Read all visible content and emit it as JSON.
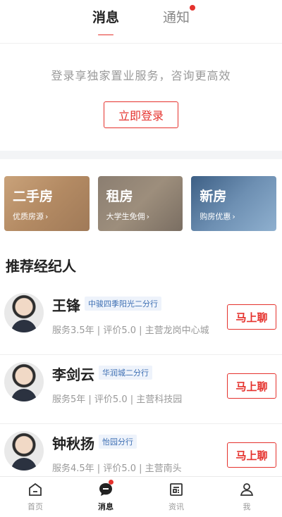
{
  "tabs": [
    {
      "label": "消息",
      "active": true
    },
    {
      "label": "通知",
      "active": false,
      "has_dot": true
    }
  ],
  "login": {
    "tip": "登录享独家置业服务，咨询更高效",
    "button": "立即登录"
  },
  "cards": [
    {
      "title": "二手房",
      "subtitle": "优质房源",
      "theme": "#c9a27a"
    },
    {
      "title": "租房",
      "subtitle": "大学生免佣",
      "theme": "#8b7e71"
    },
    {
      "title": "新房",
      "subtitle": "购房优惠",
      "theme": "#3d5f85"
    }
  ],
  "section_title": "推荐经纪人",
  "agents": [
    {
      "name": "王锋",
      "branch": "中骏四季阳光二分行",
      "meta": "服务3.5年 | 评价5.0 | 主营龙岗中心城",
      "button": "马上聊"
    },
    {
      "name": "李剑云",
      "branch": "华润城二分行",
      "meta": "服务5年 | 评价5.0 | 主营科技园",
      "button": "马上聊"
    },
    {
      "name": "钟秋扬",
      "branch": "怡园分行",
      "meta": "服务4.5年 | 评价5.0 | 主营南头",
      "button": "马上聊"
    }
  ],
  "bottom_nav": [
    {
      "label": "首页",
      "icon": "home-icon"
    },
    {
      "label": "消息",
      "icon": "message-icon",
      "active": true,
      "has_dot": true
    },
    {
      "label": "资讯",
      "icon": "news-icon"
    },
    {
      "label": "我",
      "icon": "profile-icon"
    }
  ],
  "colors": {
    "accent": "#e5322d",
    "branch_text": "#3d6fb3",
    "muted": "#999999"
  }
}
